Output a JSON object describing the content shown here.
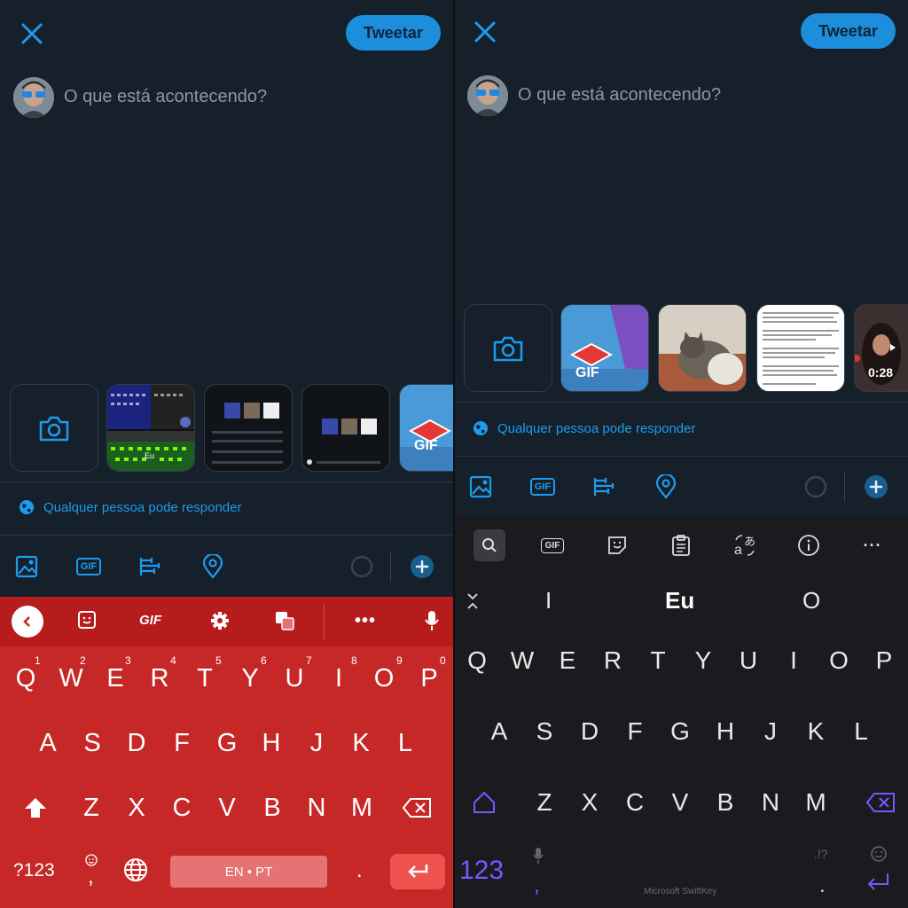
{
  "compose": {
    "tweet_label": "Tweetar",
    "placeholder": "O que está acontecendo?",
    "reply_setting": "Qualquer pessoa pode responder"
  },
  "left_keyboard": {
    "toolbar_gif": "GIF",
    "row1": [
      "Q",
      "W",
      "E",
      "R",
      "T",
      "Y",
      "U",
      "I",
      "O",
      "P"
    ],
    "row1_numbers": [
      "1",
      "2",
      "3",
      "4",
      "5",
      "6",
      "7",
      "8",
      "9",
      "0"
    ],
    "row2": [
      "A",
      "S",
      "D",
      "F",
      "G",
      "H",
      "J",
      "K",
      "L"
    ],
    "row3": [
      "Z",
      "X",
      "C",
      "V",
      "B",
      "N",
      "M"
    ],
    "symbols_label": "?123",
    "comma": ",",
    "period": ".",
    "space_label": "EN • PT"
  },
  "right_keyboard": {
    "toolbar_gif": "GIF",
    "suggestions": [
      "I",
      "Eu",
      "O"
    ],
    "row1": [
      "Q",
      "W",
      "E",
      "R",
      "T",
      "Y",
      "U",
      "I",
      "O",
      "P"
    ],
    "row2": [
      "A",
      "S",
      "D",
      "F",
      "G",
      "H",
      "J",
      "K",
      "L"
    ],
    "row3": [
      "Z",
      "X",
      "C",
      "V",
      "B",
      "N",
      "M"
    ],
    "symbols_label": "123",
    "comma": ",",
    "period": ".",
    "punct_hint": ".!?",
    "brand": "Microsoft SwiftKey"
  },
  "media": {
    "gif_badge": "GIF",
    "video_duration": "0:28",
    "keyboard_preview_word": "Eu"
  },
  "colors": {
    "background": "#15202b",
    "accent": "#1d9bf0",
    "gboard_red": "#c62828",
    "swiftkey_bg": "#1b1b1f",
    "swiftkey_accent": "#6f5cff"
  }
}
